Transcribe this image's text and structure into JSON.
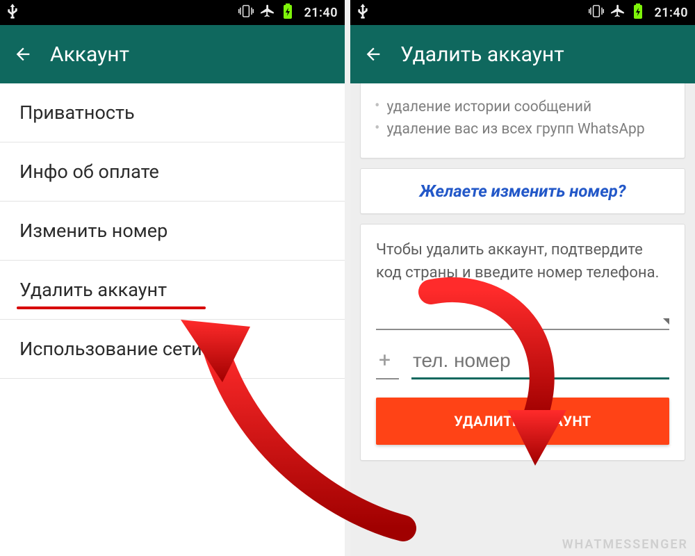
{
  "status": {
    "time": "21:40",
    "icons": {
      "usb": "usb-icon",
      "vibrate": "vibrate-icon",
      "airplane": "airplane-icon",
      "battery": "battery-icon"
    }
  },
  "left": {
    "title": "Аккаунт",
    "menu": [
      "Приватность",
      "Инфо об оплате",
      "Изменить номер",
      "Удалить аккаунт",
      "Использование сети"
    ]
  },
  "right": {
    "title": "Удалить аккаунт",
    "bullets": [
      "удаление истории сообщений",
      "удаление вас из всех групп WhatsApp"
    ],
    "change_link": "Желаете изменить номер?",
    "instruction": "Чтобы удалить аккаунт, подтвердите код страны и введите номер телефона.",
    "cc_prefix": "+",
    "tel_placeholder": "тел. номер",
    "delete_button": "УДАЛИТЬ АККАУНТ"
  },
  "watermark": "WHATMESSENGER",
  "colors": {
    "teal": "#0f685e",
    "orange": "#ff4316",
    "annotation_red": "#d70000",
    "link_blue": "#2358c8"
  }
}
